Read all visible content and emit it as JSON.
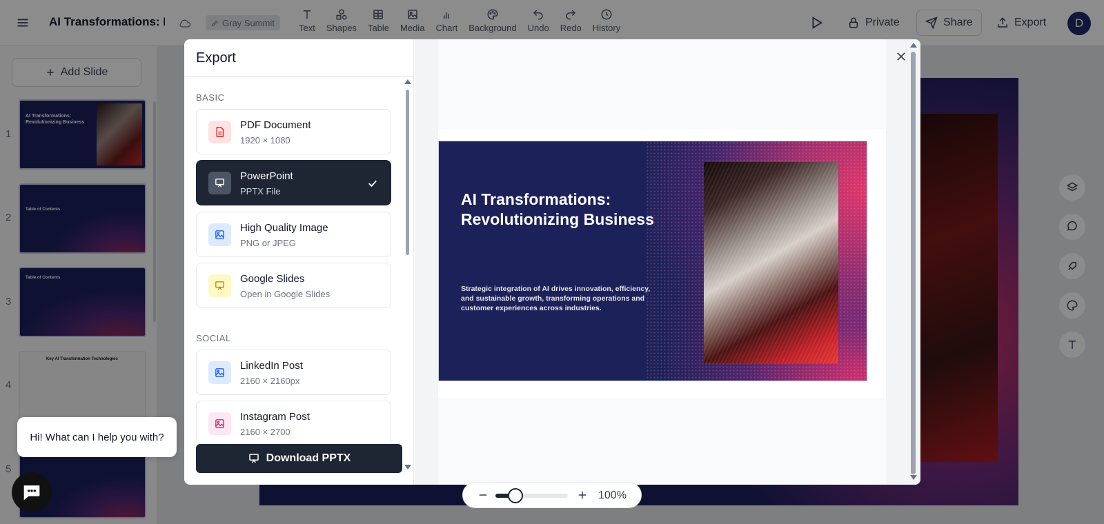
{
  "header": {
    "title": "AI Transformations: Revo",
    "workspace": "Gray Summit",
    "tools": [
      {
        "label": "Text",
        "icon": "text-icon"
      },
      {
        "label": "Shapes",
        "icon": "shapes-icon"
      },
      {
        "label": "Table",
        "icon": "table-icon"
      },
      {
        "label": "Media",
        "icon": "media-icon"
      },
      {
        "label": "Chart",
        "icon": "chart-icon"
      },
      {
        "label": "Background",
        "icon": "palette-icon"
      },
      {
        "label": "Undo",
        "icon": "undo-icon"
      },
      {
        "label": "Redo",
        "icon": "redo-icon"
      },
      {
        "label": "History",
        "icon": "clock-icon"
      }
    ],
    "private_label": "Private",
    "share_label": "Share",
    "export_label": "Export",
    "avatar_initial": "D"
  },
  "sidebar": {
    "add_slide_label": "Add Slide",
    "slide_numbers": [
      "1",
      "2",
      "3",
      "4",
      "5"
    ],
    "thumb1_title": "AI Transformations: Revolutionizing Business",
    "thumb2_title": "Table of Contents",
    "thumb3_title": "Table of Contents",
    "thumb4_title": "Key AI Transformation Technologies"
  },
  "export_modal": {
    "title": "Export",
    "sections": {
      "basic": "BASIC",
      "social": "SOCIAL"
    },
    "options": [
      {
        "label": "PDF Document",
        "sub": "1920 × 1080",
        "color": "#fee2e2",
        "icon_color": "#dc2626"
      },
      {
        "label": "PowerPoint",
        "sub": "PPTX File",
        "selected": true
      },
      {
        "label": "High Quality Image",
        "sub": "PNG or JPEG",
        "color": "#dbeafe",
        "icon_color": "#2563eb"
      },
      {
        "label": "Google Slides",
        "sub": "Open in Google Slides",
        "color": "#fef9c3",
        "icon_color": "#ca8a04"
      },
      {
        "label": "LinkedIn Post",
        "sub": "2160 × 2160px",
        "color": "#dbeafe",
        "icon_color": "#2563eb"
      },
      {
        "label": "Instagram Post",
        "sub": "2160 × 2700",
        "color": "#fce7f3",
        "icon_color": "#db2777"
      }
    ],
    "download_label": "Download PPTX"
  },
  "preview_slide": {
    "heading": "AI Transformations: Revolutionizing Business",
    "body": "Strategic integration of AI drives innovation, efficiency, and sustainable growth, transforming operations and customer experiences across industries."
  },
  "zoom": {
    "percent": "100%",
    "level": 0.25
  },
  "chat": {
    "greeting": "Hi! What can I help you with?"
  }
}
